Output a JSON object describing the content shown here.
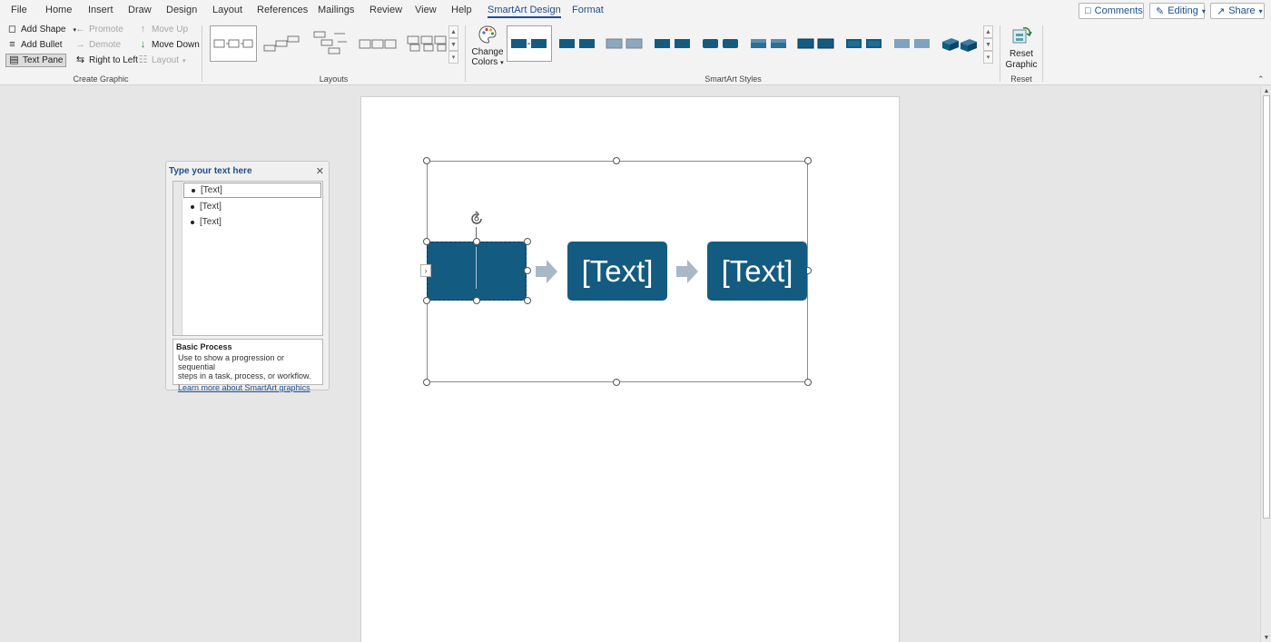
{
  "menu_tabs": [
    "File",
    "Home",
    "Insert",
    "Draw",
    "Design",
    "Layout",
    "References",
    "Mailings",
    "Review",
    "View",
    "Help",
    "SmartArt Design",
    "Format"
  ],
  "top_buttons": {
    "comments": "Comments",
    "editing": "Editing",
    "share": "Share"
  },
  "create_graphic": {
    "add_shape": "Add Shape",
    "add_bullet": "Add Bullet",
    "text_pane": "Text Pane",
    "promote": "Promote",
    "demote": "Demote",
    "right_to_left": "Right to Left",
    "move_up": "Move Up",
    "move_down": "Move Down",
    "layout": "Layout",
    "label": "Create Graphic"
  },
  "layouts": {
    "label": "Layouts"
  },
  "smartart_styles": {
    "change_colors_1": "Change",
    "change_colors_2": "Colors",
    "label": "SmartArt Styles"
  },
  "reset": {
    "reset_graphic_1": "Reset",
    "reset_graphic_2": "Graphic",
    "label": "Reset"
  },
  "text_pane": {
    "title": "Type your text here",
    "items": [
      "[Text]",
      "[Text]",
      "[Text]"
    ],
    "desc_title": "Basic Process",
    "desc_line1": "Use to show a progression or sequential",
    "desc_line2": "steps in a task, process, or workflow.",
    "learn_more": "Learn more about SmartArt graphics"
  },
  "smartart": {
    "boxes": [
      "",
      "[Text]",
      "[Text]"
    ],
    "box_color": "#145b81",
    "arrow_color": "#a9b8c5"
  },
  "colors": {
    "accent": "#1e4e8c",
    "ribbon_bg": "#f3f3f3",
    "canvas_bg": "#e6e6e6"
  }
}
